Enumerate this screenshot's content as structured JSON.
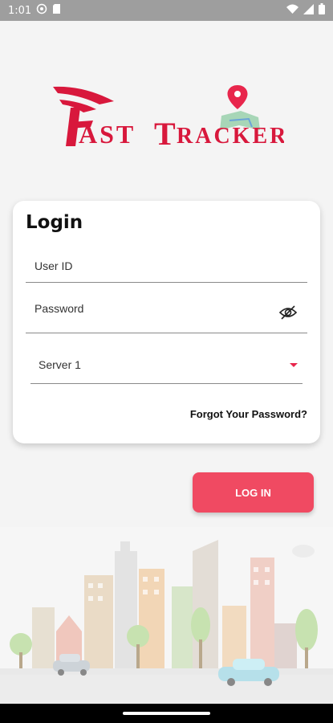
{
  "status_bar": {
    "time": "1:01"
  },
  "logo": {
    "brand": "Fast Tracker",
    "colors": {
      "red": "#d8183c"
    }
  },
  "login_card": {
    "title": "Login",
    "user_id_placeholder": "User ID",
    "password_placeholder": "Password",
    "server_selected": "Server 1",
    "forgot_link": "Forgot Your Password?"
  },
  "login_button": {
    "label": "LOG IN",
    "color": "#f04a62"
  },
  "icons": [
    "wifi-icon",
    "signal-icon",
    "battery-icon",
    "eye-off-icon",
    "dropdown-caret-icon"
  ]
}
